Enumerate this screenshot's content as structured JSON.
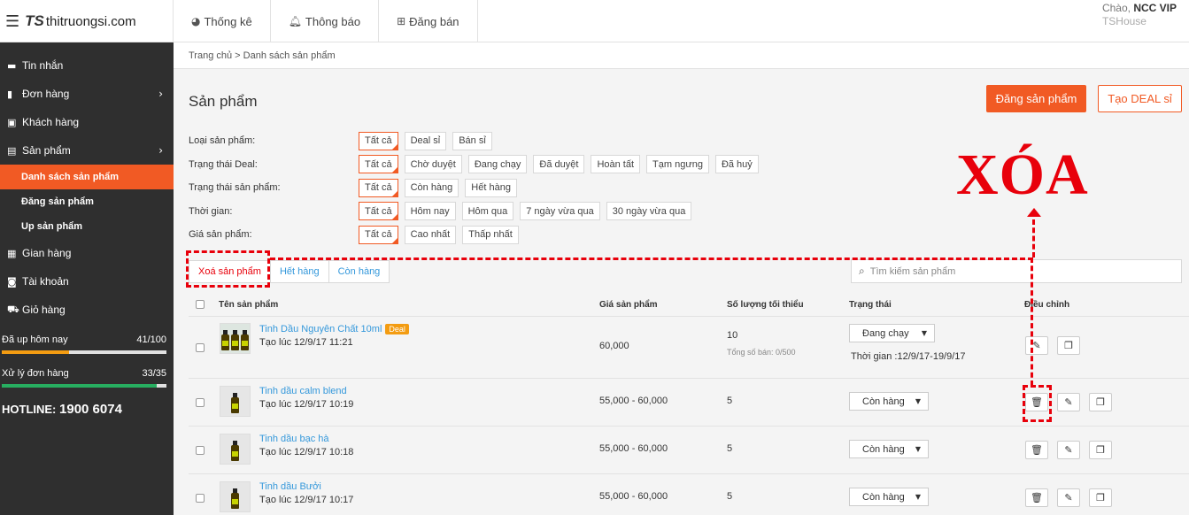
{
  "header": {
    "brand_mark": "TS",
    "brand_text": "thitruongsi.com",
    "nav": [
      {
        "label": "Thống kê",
        "icon": "pie-chart-icon"
      },
      {
        "label": "Thông báo",
        "icon": "bell-icon"
      },
      {
        "label": "Đăng bán",
        "icon": "plus-square-icon"
      }
    ],
    "greeting_prefix": "Chào,",
    "user_name": "NCC VIP",
    "shop_name": "TSHouse"
  },
  "sidebar": {
    "items": [
      {
        "label": "Tin nhắn",
        "icon": "chat-icon"
      },
      {
        "label": "Đơn hàng",
        "icon": "file-icon",
        "has_arrow": true
      },
      {
        "label": "Khách hàng",
        "icon": "contacts-icon"
      },
      {
        "label": "Sản phẩm",
        "icon": "box-icon",
        "has_arrow": true
      }
    ],
    "sub_items": [
      {
        "label": "Danh sách sản phẩm",
        "active": true
      },
      {
        "label": "Đăng sản phẩm"
      },
      {
        "label": "Up sản phẩm"
      }
    ],
    "items2": [
      {
        "label": "Gian hàng",
        "icon": "store-icon"
      },
      {
        "label": "Tài khoản",
        "icon": "user-icon"
      },
      {
        "label": "Giỏ hàng",
        "icon": "cart-icon"
      }
    ],
    "stats": [
      {
        "label": "Đã up hôm nay",
        "value_text": "41/100",
        "progress": 0.41,
        "color": "#f39c12"
      },
      {
        "label": "Xử lý đơn hàng",
        "value_text": "33/35",
        "progress": 0.943,
        "color": "#27ae60"
      }
    ],
    "hotline_label": "HOTLINE:",
    "hotline_number": "1900 6074"
  },
  "main": {
    "breadcrumb": "Trang chủ > Danh sách sản phẩm",
    "title": "Sản phẩm",
    "post_button": "Đăng sản phẩm",
    "deal_button": "Tạo DEAL sỉ",
    "filters": [
      {
        "label": "Loại sản phẩm:",
        "options": [
          "Tất cả",
          "Deal sỉ",
          "Bán sỉ"
        ]
      },
      {
        "label": "Trạng thái Deal:",
        "options": [
          "Tất cả",
          "Chờ duyệt",
          "Đang chạy",
          "Đã duyệt",
          "Hoàn tất",
          "Tạm ngưng",
          "Đã huỷ"
        ]
      },
      {
        "label": "Trạng thái sản phẩm:",
        "options": [
          "Tất cả",
          "Còn hàng",
          "Hết hàng"
        ]
      },
      {
        "label": "Thời gian:",
        "options": [
          "Tất cả",
          "Hôm nay",
          "Hôm qua",
          "7 ngày vừa qua",
          "30 ngày vừa qua"
        ]
      },
      {
        "label": "Giá sản phẩm:",
        "options": [
          "Tất cả",
          "Cao nhất",
          "Thấp nhất"
        ]
      }
    ],
    "annotation": "XÓA",
    "tabs": [
      "Xoá sản phẩm",
      "Hết hàng",
      "Còn hàng"
    ],
    "search_placeholder": "Tìm kiếm sản phẩm",
    "columns": [
      "Tên sản phẩm",
      "Giá sản phẩm",
      "Số lượng tối thiểu",
      "Trạng thái",
      "Điều chỉnh"
    ],
    "rows": [
      {
        "name": "Tinh Dầu Nguyên Chất 10ml",
        "badge": "Deal",
        "created": "Tạo lúc 12/9/17 11:21",
        "price": "60,000",
        "qty": "10",
        "sold": "Tổng số bán:  0/500",
        "status": "Đang chạy",
        "time": "Thời gian :12/9/17-19/9/17"
      },
      {
        "name": "Tinh dầu calm blend",
        "created": "Tạo lúc 12/9/17 10:19",
        "price": "55,000 - 60,000",
        "qty": "5",
        "status": "Còn hàng"
      },
      {
        "name": "Tinh dầu bạc hà",
        "created": "Tạo lúc 12/9/17 10:18",
        "price": "55,000 - 60,000",
        "qty": "5",
        "status": "Còn hàng"
      },
      {
        "name": "Tinh dầu Bưởi",
        "created": "Tạo lúc 12/9/17 10:17",
        "price": "55,000 - 60,000",
        "qty": "5",
        "status": "Còn hàng"
      }
    ]
  },
  "colors": {
    "accent": "#f15a24",
    "annotation": "#e8000b",
    "link": "#3498db",
    "sidebar": "#2f2f2f"
  }
}
